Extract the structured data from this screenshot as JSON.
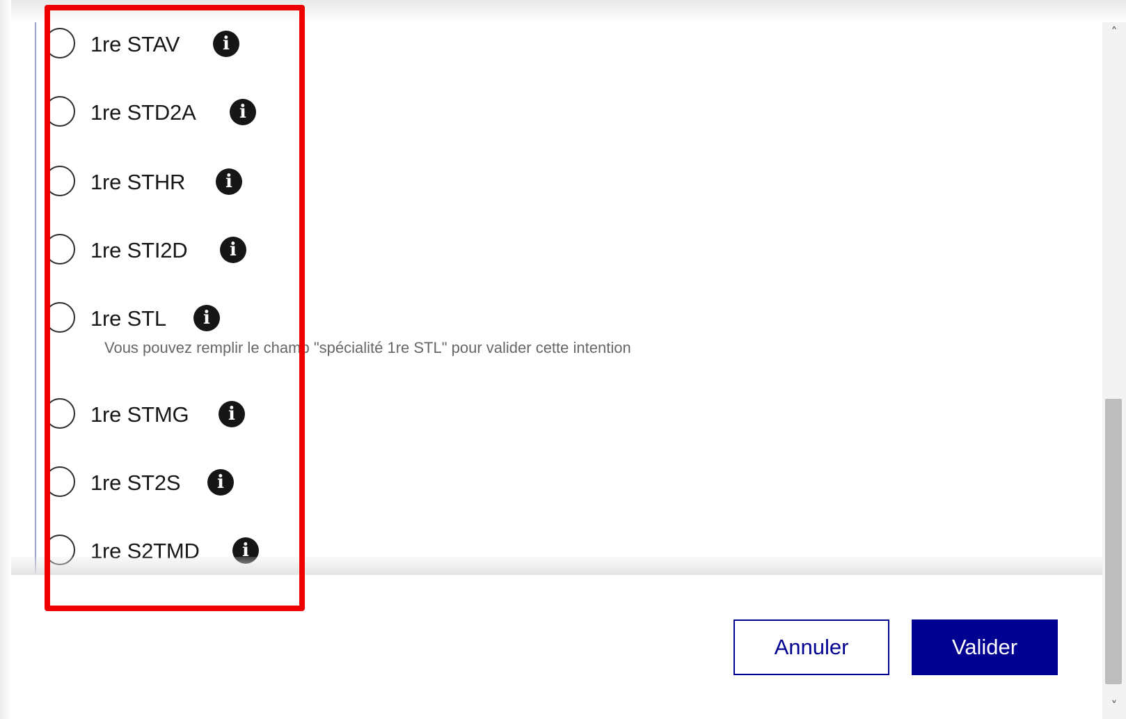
{
  "options": [
    {
      "level": "1re",
      "code": "STAV"
    },
    {
      "level": "1re",
      "code": "STD2A"
    },
    {
      "level": "1re",
      "code": "STHR"
    },
    {
      "level": "1re",
      "code": "STI2D"
    },
    {
      "level": "1re",
      "code": "STL",
      "hint": "Vous pouvez remplir le champ \"spécialité 1re STL\" pour valider cette intention"
    },
    {
      "level": "1re",
      "code": "STMG"
    },
    {
      "level": "1re",
      "code": "ST2S"
    },
    {
      "level": "1re",
      "code": "S2TMD"
    }
  ],
  "info_glyph": "i",
  "icons": {
    "info": "info-circle-icon",
    "scroll_up": "chevron-up-icon",
    "scroll_down": "chevron-down-icon"
  },
  "footer": {
    "cancel_label": "Annuler",
    "validate_label": "Valider"
  },
  "scroll_arrows": {
    "up": "˄",
    "down": "˅"
  },
  "colors": {
    "primary": "#000091",
    "highlight_box": "#ee0000",
    "text": "#161616",
    "hint_text": "#666666"
  }
}
